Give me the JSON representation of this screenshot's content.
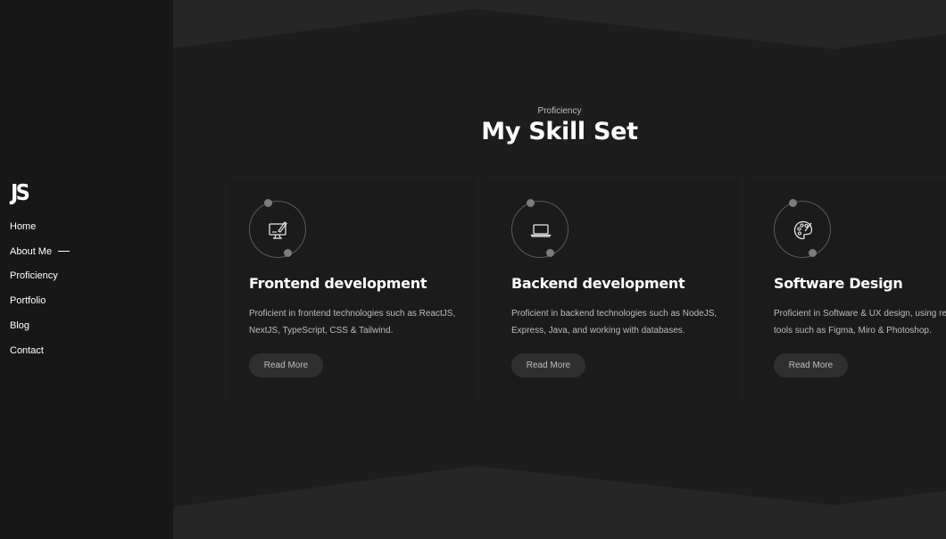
{
  "sidebar": {
    "logo": "JS",
    "nav": [
      {
        "label": "Home"
      },
      {
        "label": "About Me"
      },
      {
        "label": "Proficiency"
      },
      {
        "label": "Portfolio"
      },
      {
        "label": "Blog"
      },
      {
        "label": "Contact"
      }
    ]
  },
  "section": {
    "eyebrow": "Proficiency",
    "title": "My Skill Set"
  },
  "cards": [
    {
      "icon": "monitor-design-icon",
      "title": "Frontend development",
      "text": "Proficient in frontend technologies such as ReactJS, NextJS, TypeScript, CSS & Tailwind.",
      "button": "Read More"
    },
    {
      "icon": "laptop-icon",
      "title": "Backend development",
      "text": "Proficient in backend technologies such as NodeJS, Express, Java, and working with databases.",
      "button": "Read More"
    },
    {
      "icon": "palette-icon",
      "title": "Software Design",
      "text": "Proficient in Software & UX design, using relevant tools such as Figma, Miro & Photoshop.",
      "button": "Read More"
    }
  ],
  "colors": {
    "sidebar_bg": "#171717",
    "main_bg": "#1d1d1d",
    "band_bg": "#262626",
    "card_bg": "#1b1b1b",
    "button_bg": "#2f2f2f"
  }
}
